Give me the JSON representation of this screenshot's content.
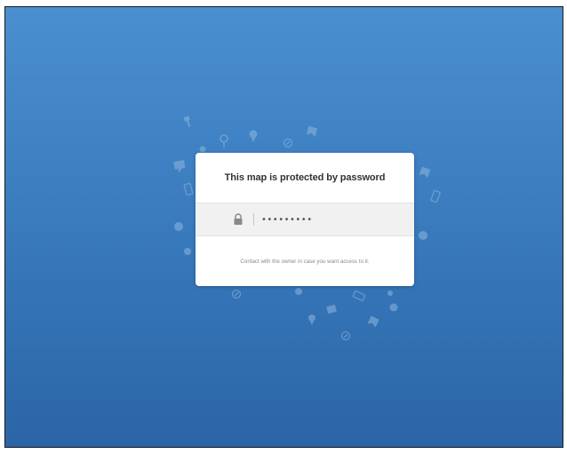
{
  "dialog": {
    "title": "This map is protected by password",
    "password_value": "•••••••••",
    "help_text": "Contact with the owner in case you want access to it."
  },
  "icons": {
    "lock": "lock-icon",
    "background_pattern": [
      "map-pin-icon",
      "pushpin-icon",
      "compass-icon",
      "speech-bubble-icon",
      "phone-icon",
      "bookmark-icon",
      "chat-icon"
    ]
  },
  "colors": {
    "background_top": "#4a8fcf",
    "background_bottom": "#2b65a6",
    "dialog_background": "#ffffff",
    "input_row_background": "#f1f1f1",
    "title_text": "#333333",
    "help_text": "#8a8a8a"
  }
}
